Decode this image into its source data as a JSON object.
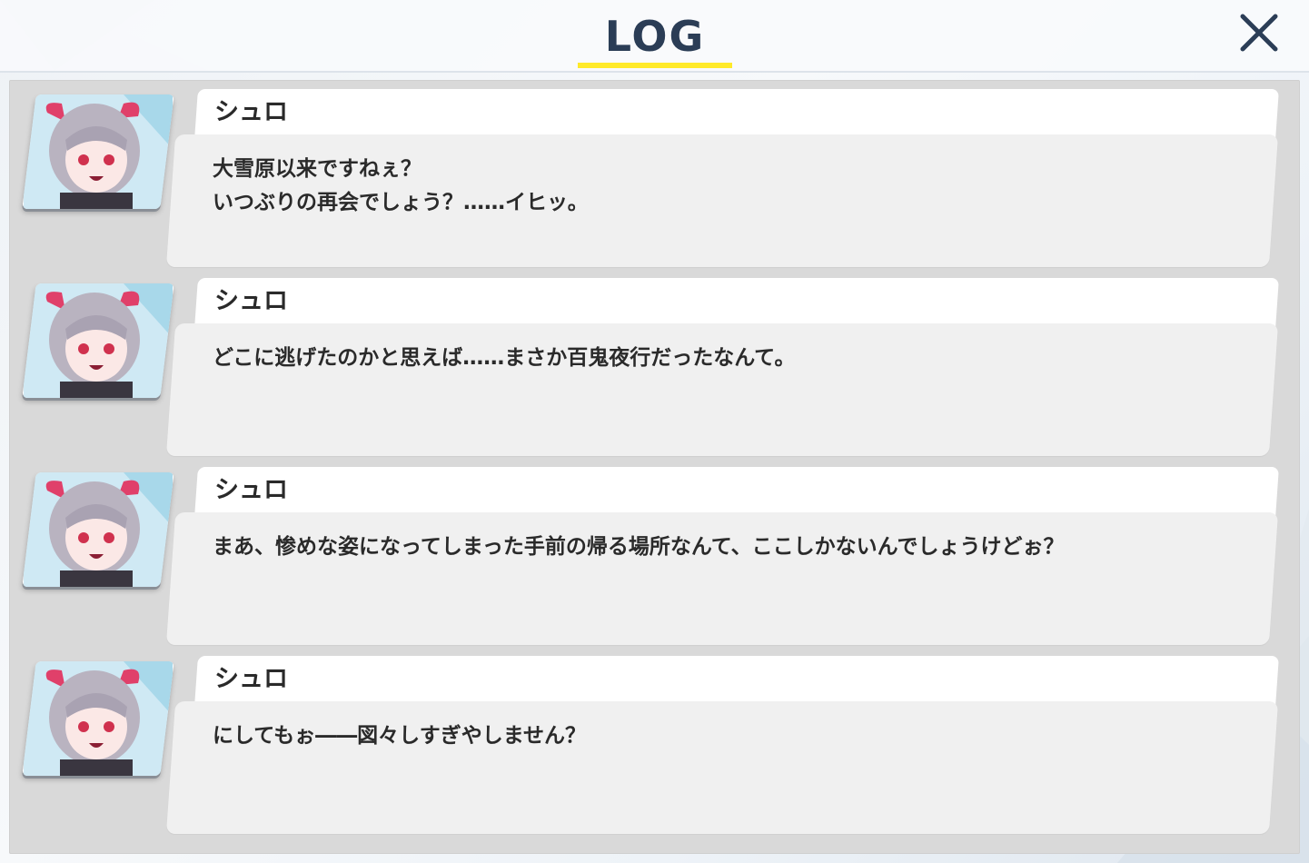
{
  "header": {
    "title": "LOG",
    "close_icon": "close-icon",
    "accent_color": "#ffea2a",
    "title_color": "#2b3d56"
  },
  "entries": [
    {
      "speaker": "シュロ",
      "avatar_icon": "character-portrait",
      "text": "大雪原以来ですねぇ？\nいつぶりの再会でしょう？……イヒッ。"
    },
    {
      "speaker": "シュロ",
      "avatar_icon": "character-portrait",
      "text": "どこに逃げたのかと思えば……まさか百鬼夜行だったなんて。"
    },
    {
      "speaker": "シュロ",
      "avatar_icon": "character-portrait",
      "text": "まあ、惨めな姿になってしまった手前の帰る場所なんて、ここしかないんでしょうけどぉ？"
    },
    {
      "speaker": "シュロ",
      "avatar_icon": "character-portrait",
      "text": "にしてもぉ――図々しすぎやしません？"
    }
  ]
}
